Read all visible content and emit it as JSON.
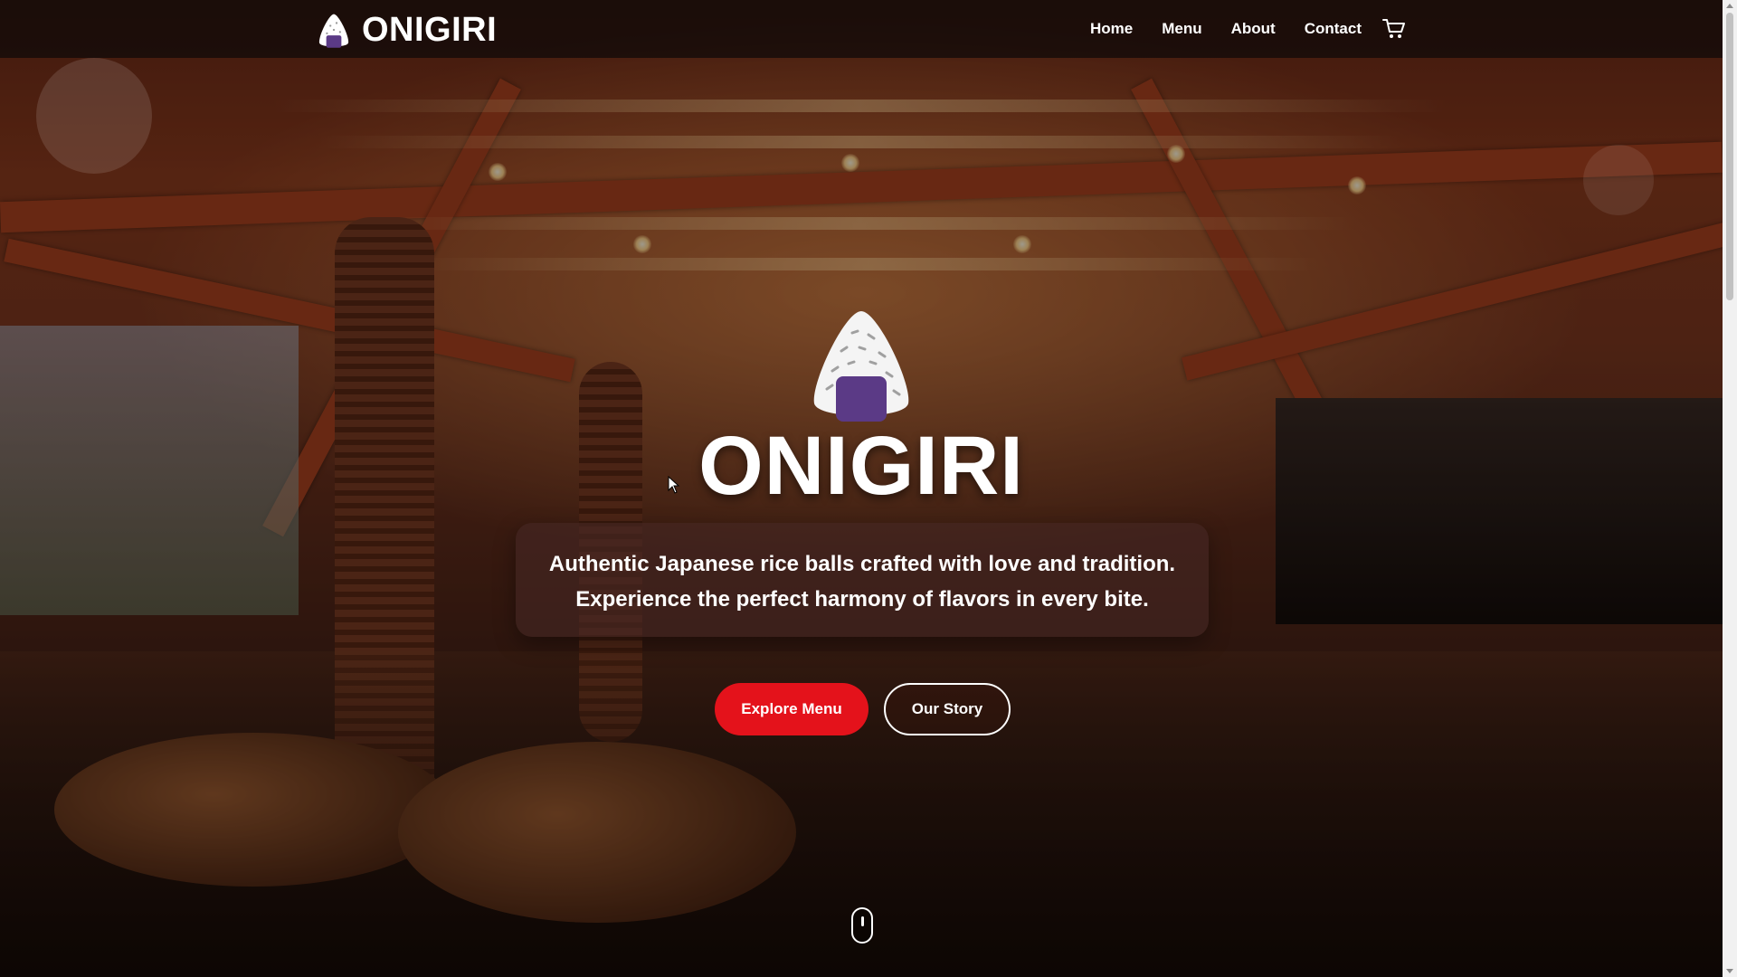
{
  "brand": {
    "name": "ONIGIRI",
    "logo_icon": "onigiri-icon"
  },
  "nav": {
    "items": [
      {
        "label": "Home"
      },
      {
        "label": "Menu"
      },
      {
        "label": "About"
      },
      {
        "label": "Contact"
      }
    ],
    "cart_icon": "cart-icon"
  },
  "hero": {
    "logo_icon": "onigiri-icon",
    "title": "ONIGIRI",
    "tagline_line1": "Authentic Japanese rice balls crafted with love and tradition.",
    "tagline_line2": "Experience the perfect harmony of flavors in every bite.",
    "primary_button": "Explore Menu",
    "secondary_button": "Our Story",
    "scroll_icon": "mouse-scroll-icon"
  },
  "colors": {
    "accent": "#e4121b",
    "nori": "#5b3a86",
    "header_bg": "#0c0808",
    "text": "#ffffff"
  }
}
